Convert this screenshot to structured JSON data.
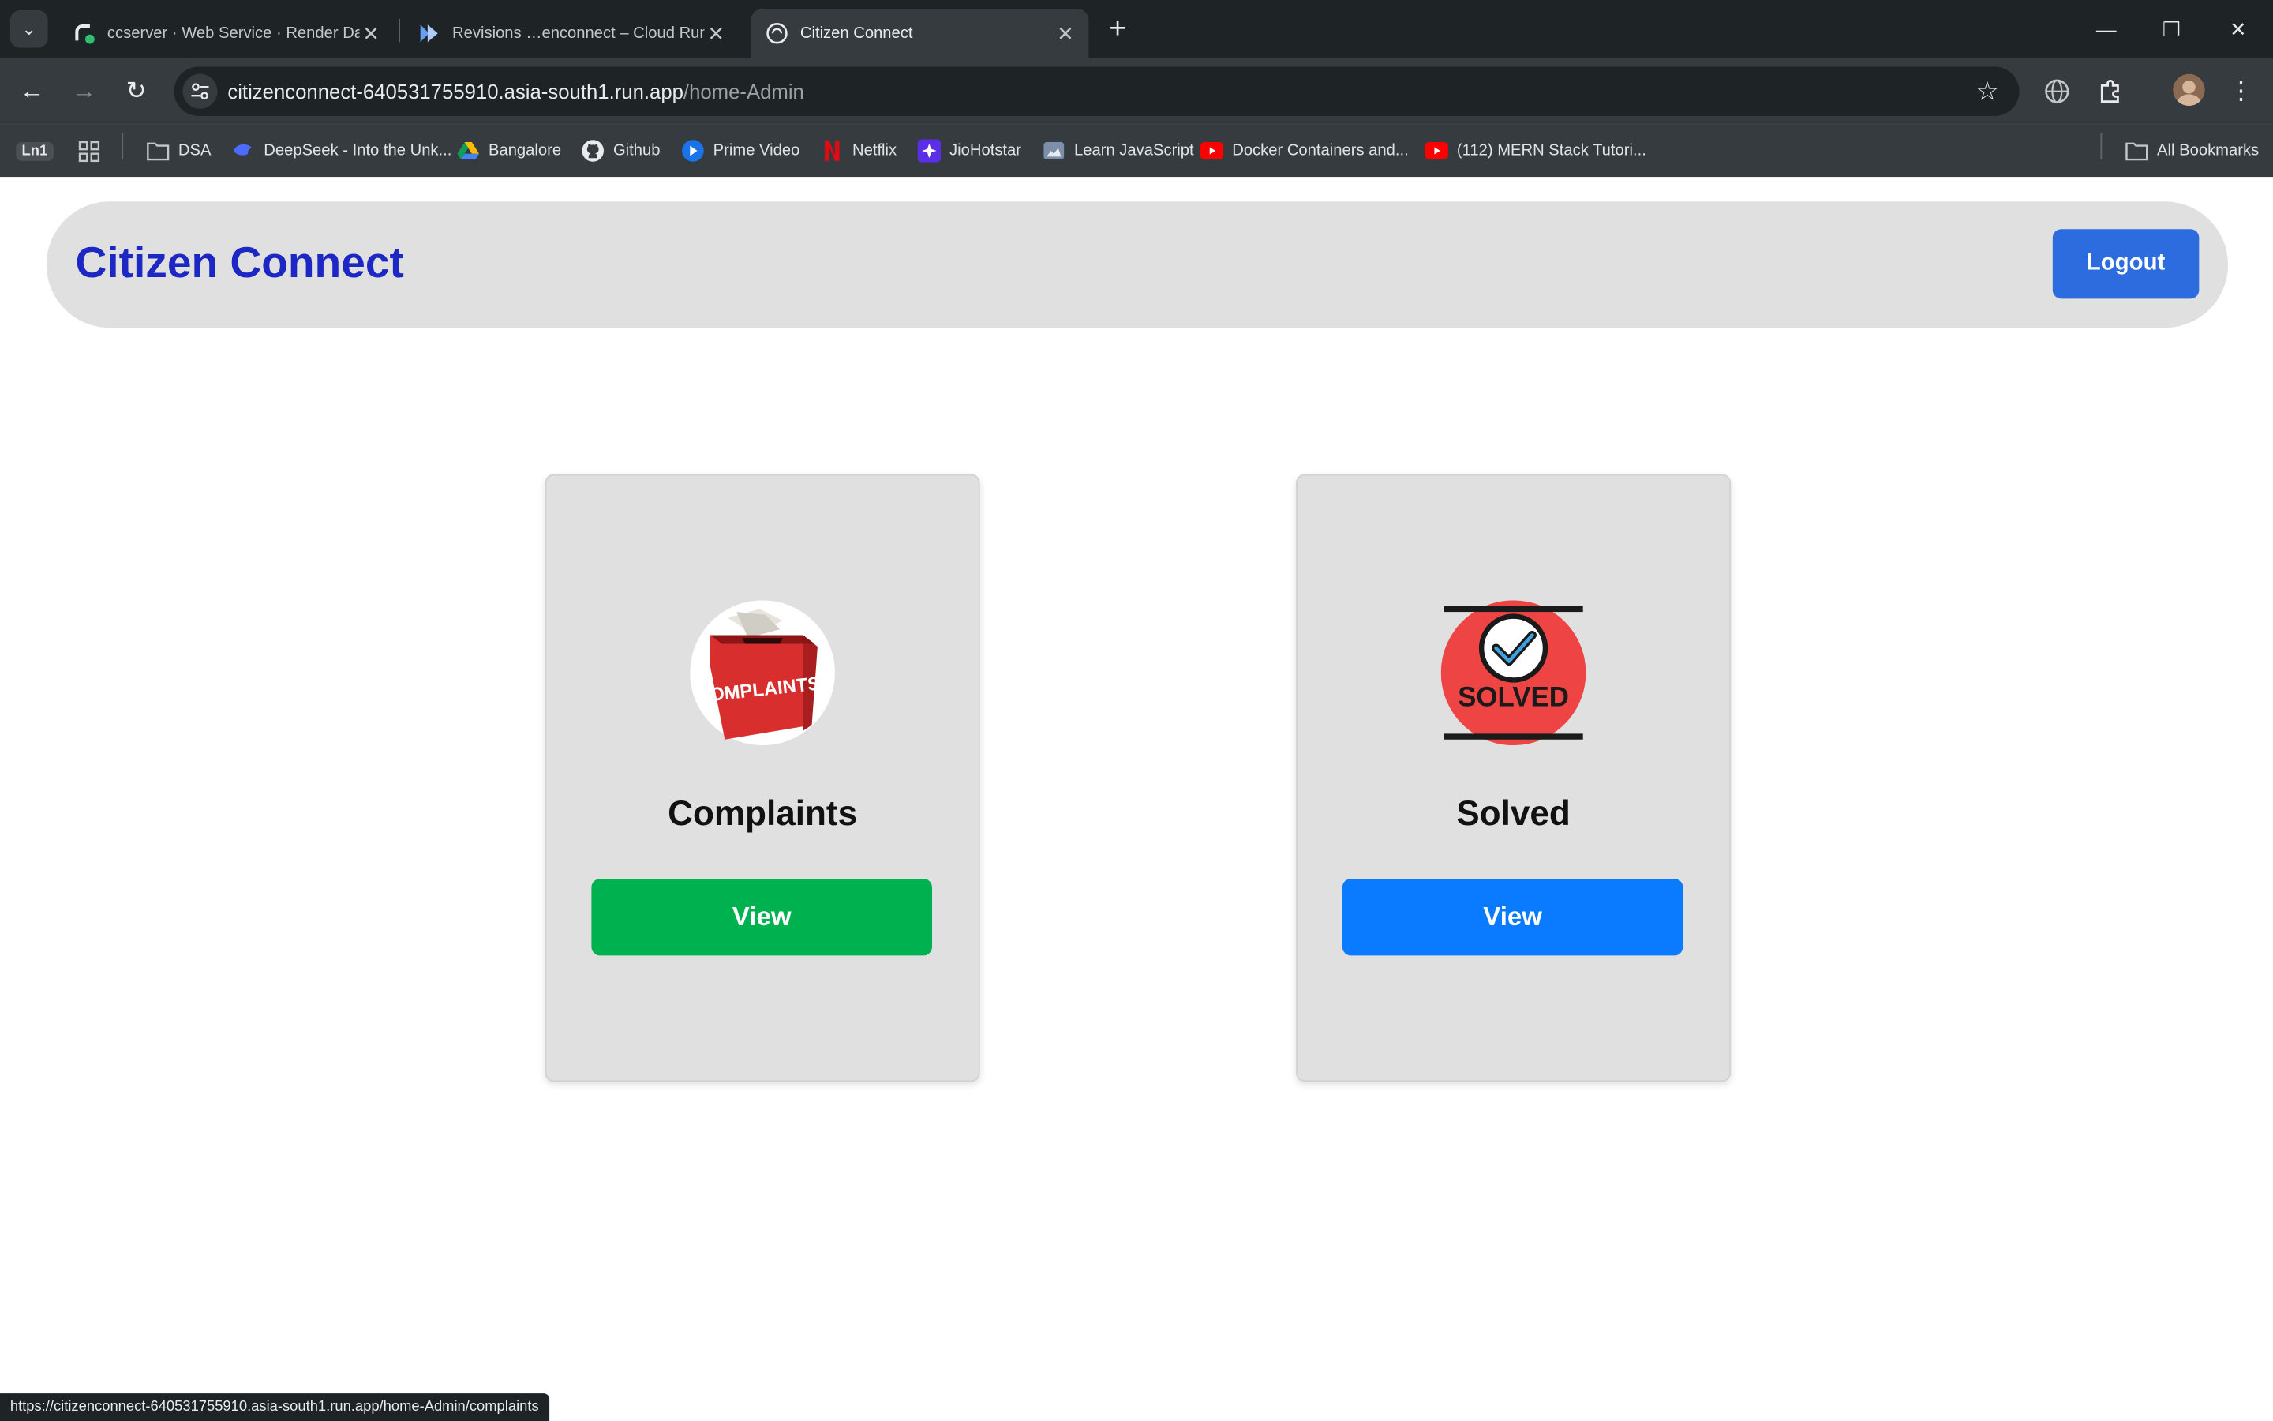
{
  "browser": {
    "tabs": [
      {
        "title": "ccserver · Web Service · Render Dash",
        "icon": "render-icon"
      },
      {
        "title": "Revisions …enconnect – Cloud Run – ",
        "icon": "cloud-run-icon"
      },
      {
        "title": "Citizen Connect",
        "icon": "citizen-connect-favicon",
        "active": true
      }
    ],
    "url_host": "citizenconnect-640531755910.asia-south1.run.app",
    "url_path": "/home-Admin",
    "bookmarks": [
      {
        "label": "",
        "icon": "ln1-icon",
        "badge": "Ln1"
      },
      {
        "label": "",
        "icon": "apps-grid-icon"
      },
      {
        "label": "DSA",
        "icon": "folder-icon"
      },
      {
        "label": "DeepSeek - Into the Unk...",
        "icon": "deepseek-icon"
      },
      {
        "label": "Bangalore",
        "icon": "google-drive-icon"
      },
      {
        "label": "Github",
        "icon": "github-icon"
      },
      {
        "label": "Prime Video",
        "icon": "prime-video-icon"
      },
      {
        "label": "Netflix",
        "icon": "netflix-icon"
      },
      {
        "label": "JioHotstar",
        "icon": "jiohotstar-icon"
      },
      {
        "label": "Learn JavaScript",
        "icon": "learn-js-icon"
      },
      {
        "label": "Docker Containers and...",
        "icon": "youtube-icon"
      },
      {
        "label": "(112) MERN Stack Tutori...",
        "icon": "youtube-icon"
      }
    ],
    "all_bookmarks_label": "All Bookmarks",
    "status_url": "https://citizenconnect-640531755910.asia-south1.run.app/home-Admin/complaints"
  },
  "app": {
    "brand": "Citizen Connect",
    "logout_label": "Logout",
    "cards": [
      {
        "title": "Complaints",
        "button_label": "View",
        "button_color": "#00b14f",
        "icon": "complaints-box-icon",
        "icon_text": "COMPLAINTS"
      },
      {
        "title": "Solved",
        "button_label": "View",
        "button_color": "#0a7bff",
        "icon": "solved-check-icon",
        "icon_text": "SOLVED"
      }
    ]
  },
  "colors": {
    "brand_text": "#1c27c4",
    "logout_button": "#2d6cdf",
    "navbar_bg": "#e0e0e0",
    "card_bg": "#e0e0e0"
  }
}
